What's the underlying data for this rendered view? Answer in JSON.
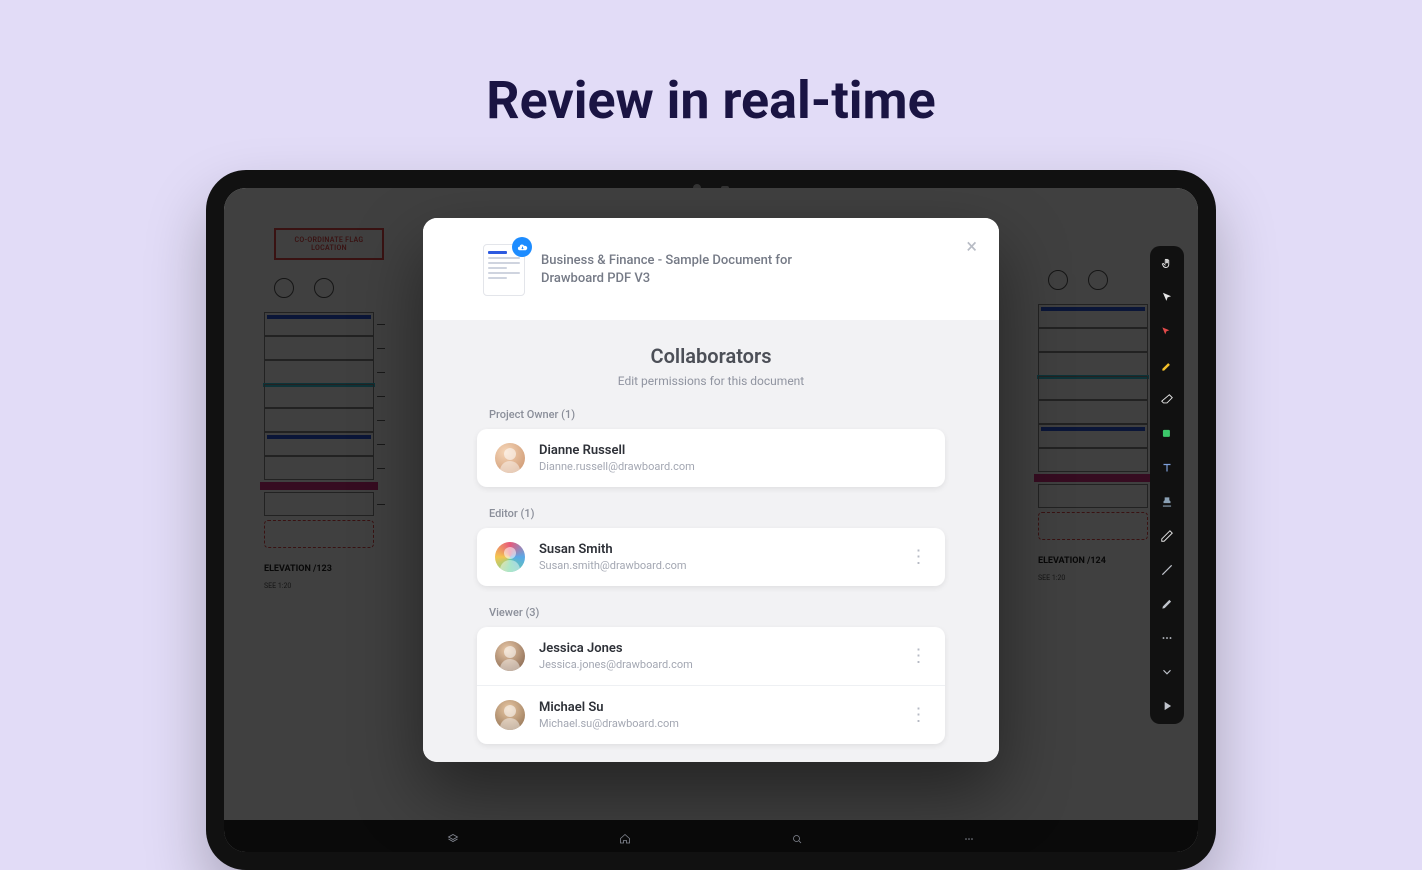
{
  "hero": {
    "title": "Review in real-time"
  },
  "drawing": {
    "callout": "CO-ORDINATE FLAG LOCATION",
    "caption_left": "ELEVATION /123",
    "caption_right": "ELEVATION /124"
  },
  "modal": {
    "doc_title": "Business & Finance - Sample Document for Drawboard PDF V3",
    "section_title": "Collaborators",
    "section_sub": "Edit permissions for this document",
    "groups": [
      {
        "label": "Project Owner (1)",
        "show_more": false,
        "users": [
          {
            "name": "Dianne Russell",
            "email": "Dianne.russell@drawboard.com",
            "avatar": "g1"
          }
        ]
      },
      {
        "label": "Editor (1)",
        "show_more": true,
        "users": [
          {
            "name": "Susan Smith",
            "email": "Susan.smith@drawboard.com",
            "avatar": "g2"
          }
        ]
      },
      {
        "label": "Viewer (3)",
        "show_more": true,
        "users": [
          {
            "name": "Jessica Jones",
            "email": "Jessica.jones@drawboard.com",
            "avatar": "g3"
          },
          {
            "name": "Michael Su",
            "email": "Michael.su@drawboard.com",
            "avatar": "g4"
          }
        ]
      }
    ]
  },
  "toolbar": {
    "tools": [
      {
        "name": "hand-icon",
        "color": "#e5e5e5"
      },
      {
        "name": "cursor-icon",
        "color": "#e5e5e5"
      },
      {
        "name": "pointer-icon",
        "color": "#e24a4a"
      },
      {
        "name": "highlighter-icon",
        "color": "#f3c02a"
      },
      {
        "name": "eraser-icon",
        "color": "#e5e5e5"
      },
      {
        "name": "shape-icon",
        "color": "#3cc76a"
      },
      {
        "name": "text-icon",
        "color": "#7ea0db"
      },
      {
        "name": "stamp-icon",
        "color": "#8aa0b4"
      },
      {
        "name": "measure-icon",
        "color": "#e5e5e5"
      },
      {
        "name": "line-icon",
        "color": "#c0c4cc"
      },
      {
        "name": "pen-icon",
        "color": "#c0c4cc"
      },
      {
        "name": "more-icon",
        "color": "#c0c4cc"
      },
      {
        "name": "chevron-down-icon",
        "color": "#c0c4cc"
      },
      {
        "name": "play-icon",
        "color": "#c0c4cc"
      }
    ]
  },
  "bottombar": {
    "items": [
      "layers-icon",
      "home-icon",
      "search-icon",
      "menu-icon"
    ]
  }
}
